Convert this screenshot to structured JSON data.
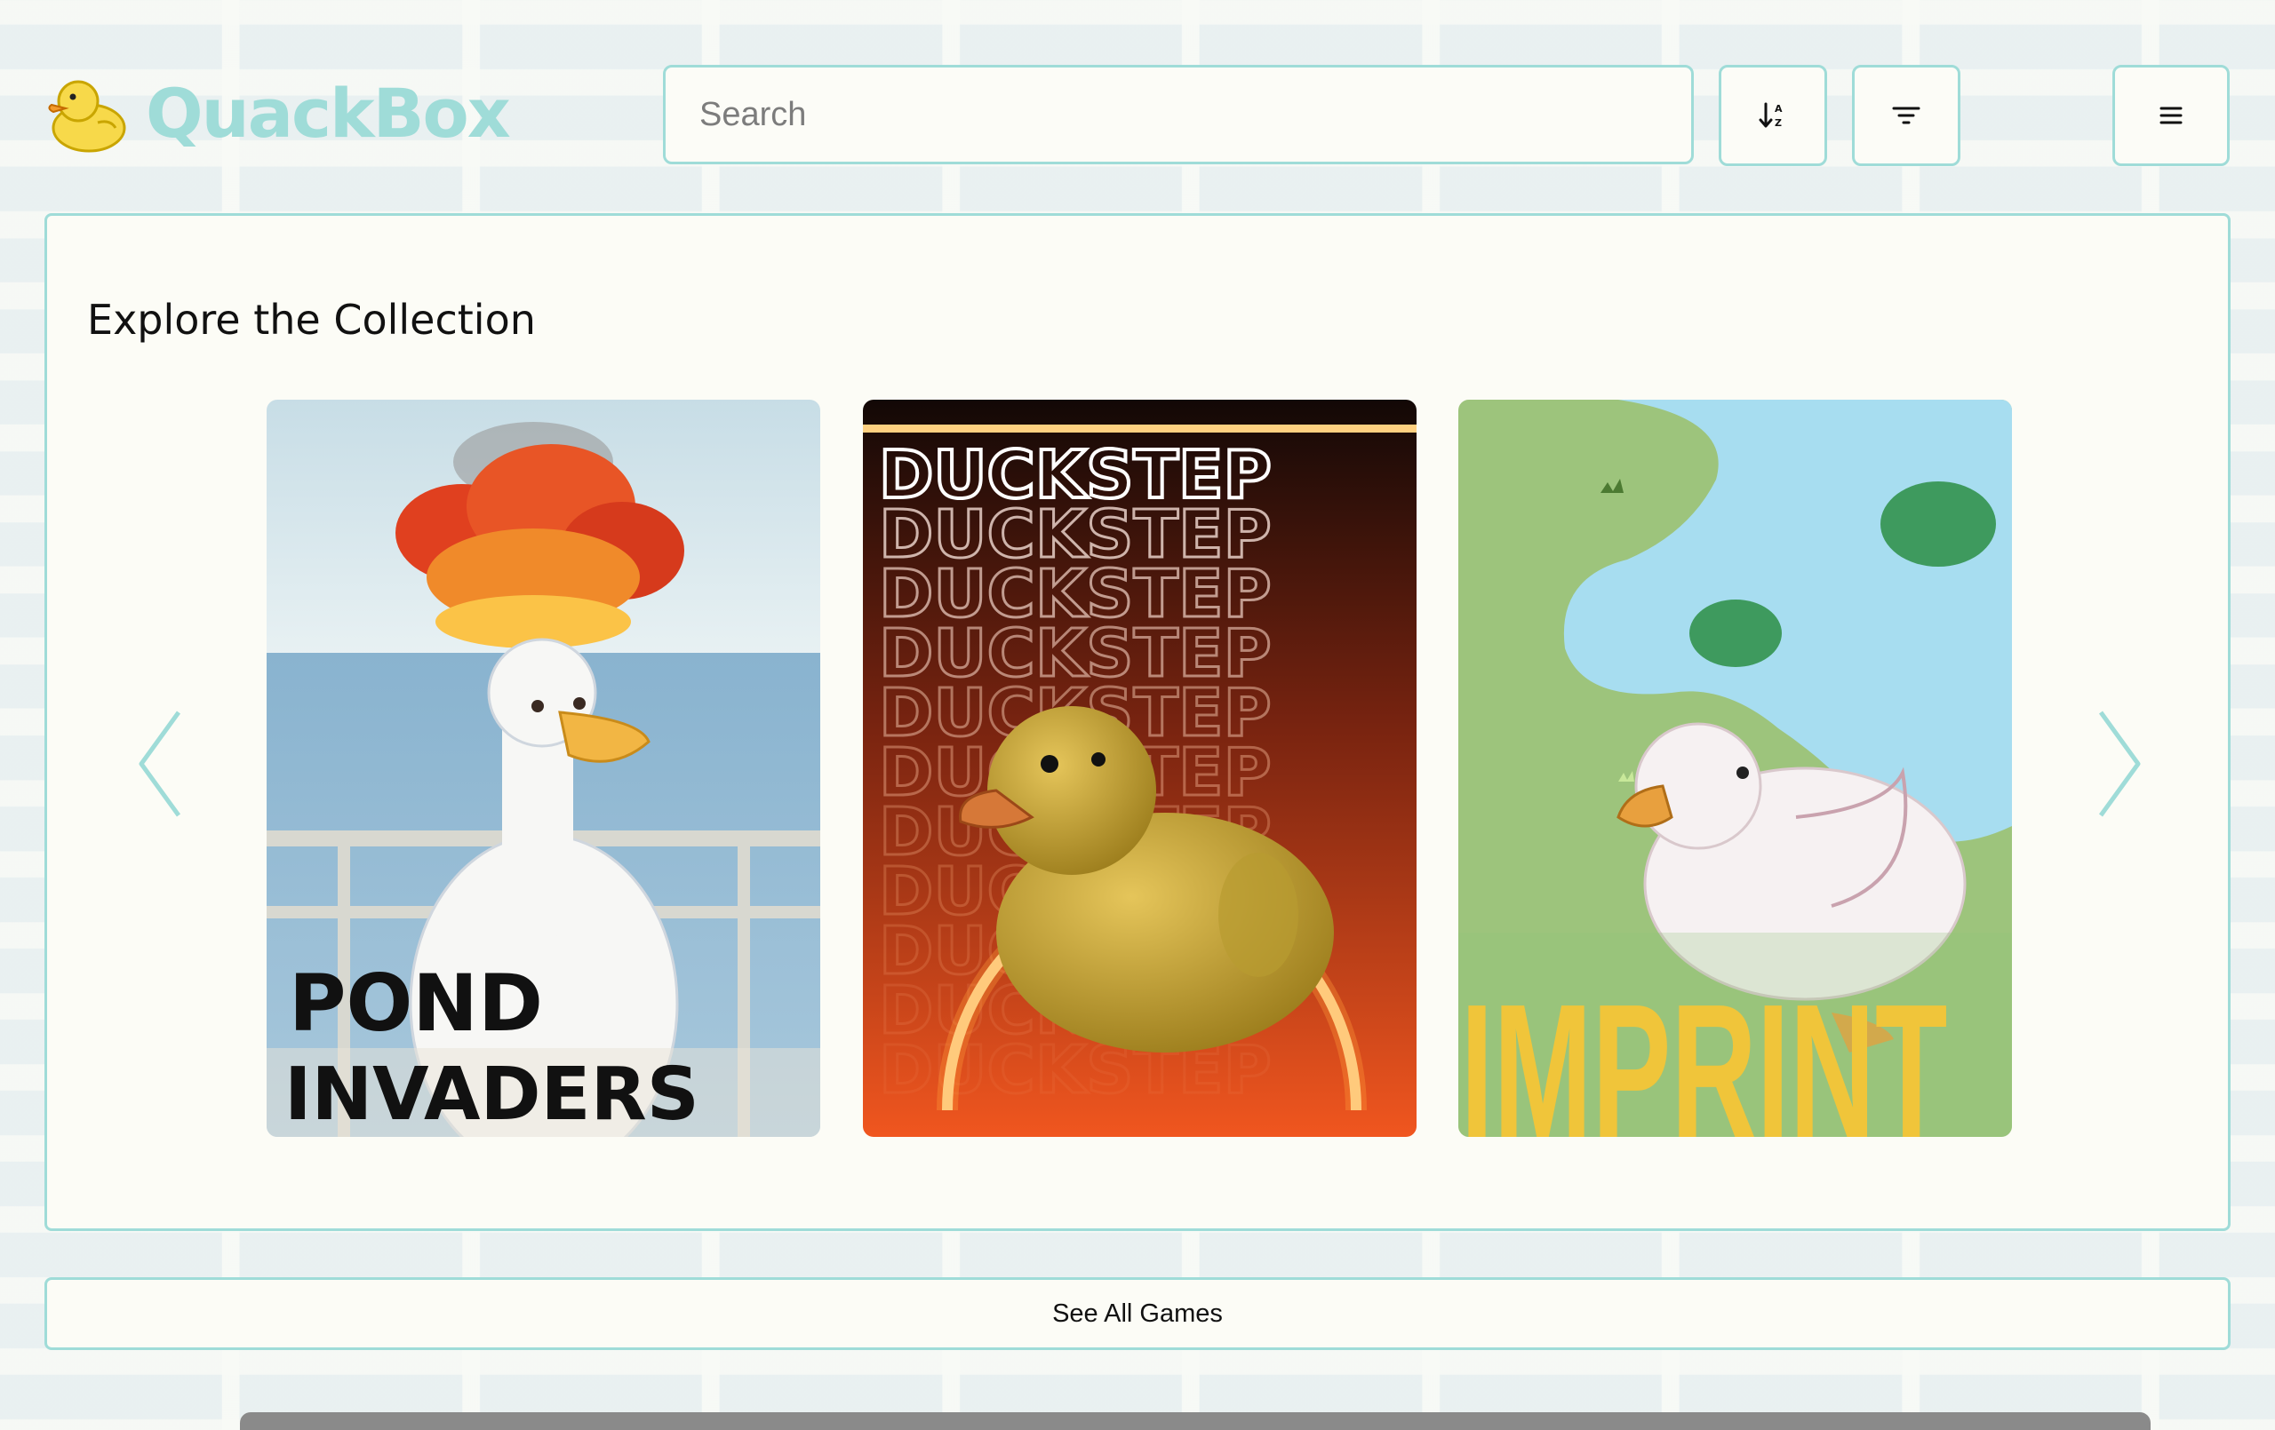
{
  "header": {
    "brand_name": "QuackBox",
    "search_placeholder": "Search",
    "search_value": "",
    "icons": {
      "logo": "rubber-duck-logo",
      "sort": "sort-alpha-icon",
      "filter": "filter-icon",
      "menu": "hamburger-menu-icon"
    }
  },
  "collection": {
    "title": "Explore the Collection",
    "games": [
      {
        "title_line1": "POND",
        "title_line2": "INVADERS"
      },
      {
        "title": "DUCKSTEP"
      },
      {
        "title": "IMPRINT"
      }
    ],
    "prev_icon": "chevron-left-icon",
    "next_icon": "chevron-right-icon"
  },
  "footer": {
    "see_all_label": "See All Games"
  },
  "colors": {
    "accent": "#9fdcd8",
    "panel_bg": "#fcfcf6",
    "duck_yellow": "#f7d94a"
  }
}
